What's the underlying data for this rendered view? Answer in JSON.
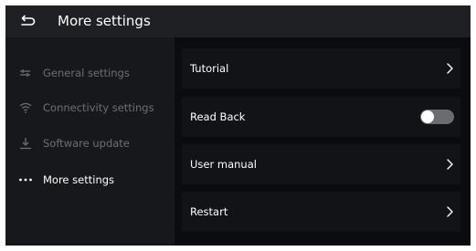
{
  "header": {
    "title": "More settings",
    "back_icon": "back-arrow-icon"
  },
  "sidebar": {
    "items": [
      {
        "label": "General settings",
        "icon": "sliders-icon",
        "active": false
      },
      {
        "label": "Connectivity settings",
        "icon": "wifi-icon",
        "active": false
      },
      {
        "label": "Software update",
        "icon": "download-icon",
        "active": false
      },
      {
        "label": "More settings",
        "icon": "more-dots-icon",
        "active": true
      }
    ]
  },
  "main": {
    "rows": [
      {
        "label": "Tutorial",
        "control": "chevron"
      },
      {
        "label": "Read Back",
        "control": "toggle",
        "toggle_on": false
      },
      {
        "label": "User manual",
        "control": "chevron"
      },
      {
        "label": "Restart",
        "control": "chevron"
      }
    ]
  },
  "colors": {
    "header_bg": "#1e2024",
    "sidebar_bg": "#17181c",
    "content_bg": "#0b0c10",
    "row_bg": "#121317",
    "inactive_text": "#6d6f74",
    "toggle_off": "#6a6c71"
  }
}
